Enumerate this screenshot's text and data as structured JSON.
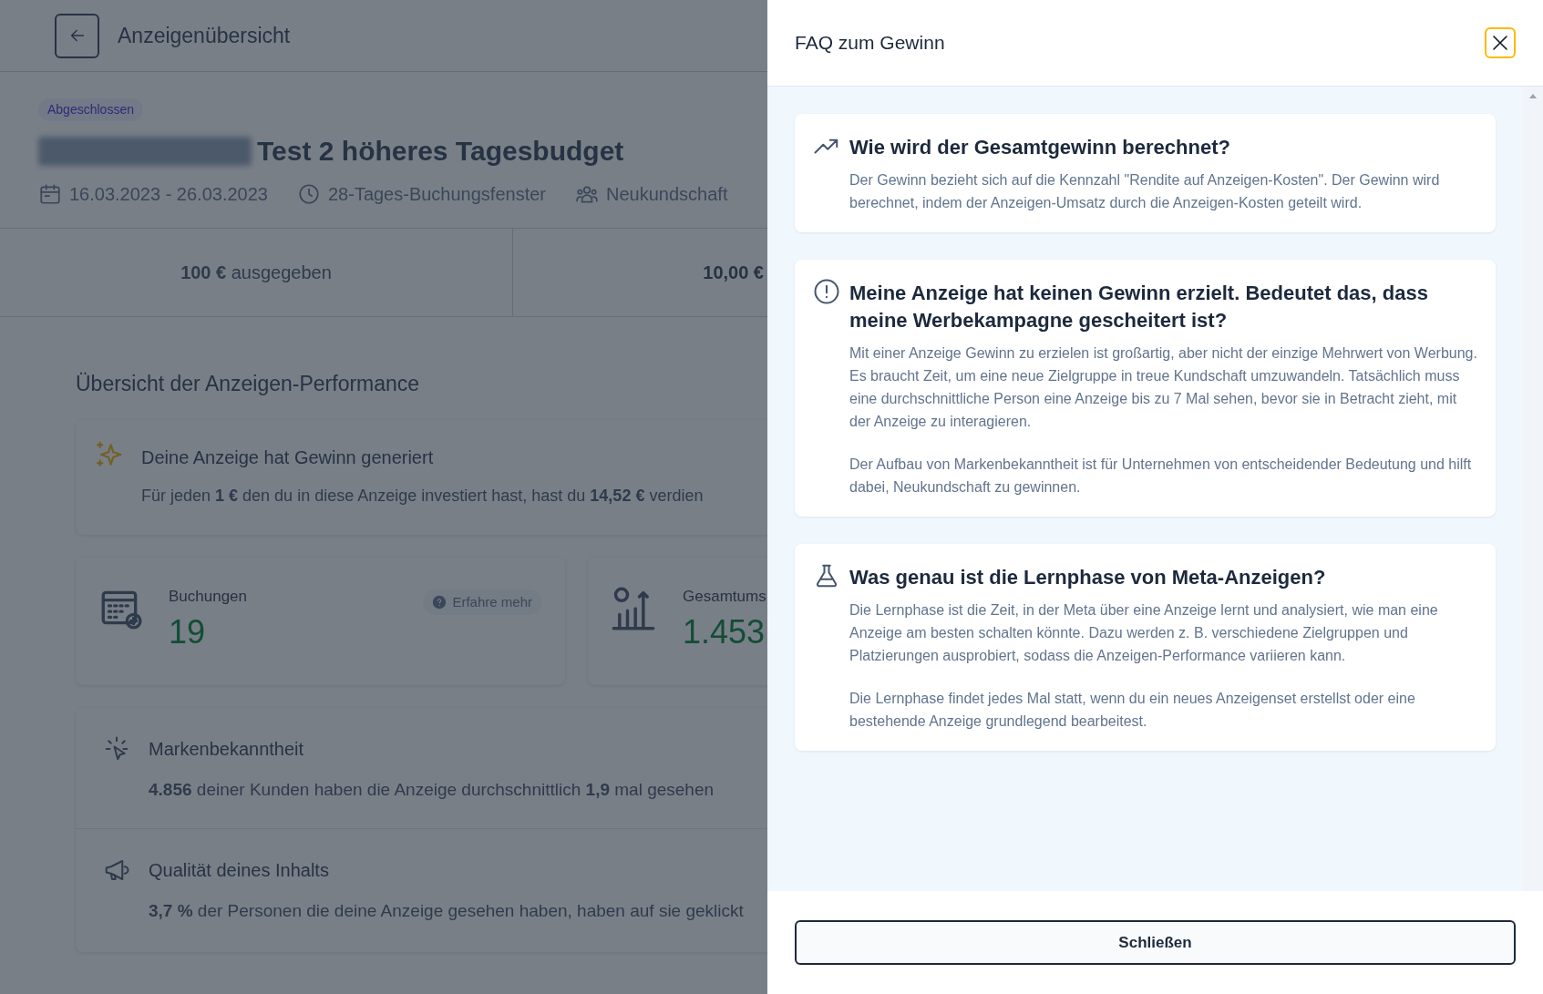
{
  "page": {
    "header_title": "Anzeigenübersicht",
    "status_badge": "Abgeschlossen",
    "ad_title": "Test 2 höheres Tagesbudget",
    "meta": [
      {
        "kind": "date",
        "text": "16.03.2023 - 26.03.2023"
      },
      {
        "kind": "clock",
        "text": "28-Tages-Buchungsfenster"
      },
      {
        "kind": "people",
        "text": "Neukundschaft"
      }
    ],
    "summary": [
      {
        "kind": "accent",
        "text": "**100 €** ausgegeben"
      },
      {
        "kind": "dark",
        "text": "10,00 €"
      }
    ],
    "section_title": "Übersicht der Anzeigen-Performance",
    "insight": {
      "title": "Deine Anzeige hat Gewinn generiert",
      "text": "Für jeden **1 €** den du in diese Anzeige investiert hast, hast du **14,52 €** verdien"
    },
    "metrics": [
      {
        "kind": "calendar",
        "label": "Buchungen",
        "value": "19",
        "help": "Erfahre mehr"
      },
      {
        "kind": "revenue",
        "label": "Gesamtums",
        "value": "1.453"
      }
    ],
    "details": [
      {
        "kind": "cursor",
        "title": "Markenbekanntheit",
        "text": "**4.856** deiner Kunden haben die Anzeige durchschnittlich **1,9** mal gesehen"
      },
      {
        "kind": "megaphone",
        "title": "Qualität deines Inhalts",
        "text": "**3,7 %** der Personen die deine Anzeige gesehen haben, haben auf sie geklickt"
      }
    ]
  },
  "drawer": {
    "title": "FAQ zum Gewinn",
    "faqs": [
      {
        "kind": "trend",
        "question": "Wie wird der Gesamtgewinn berechnet?",
        "paragraphs": [
          "Der Gewinn bezieht sich auf die Kennzahl \"Rendite auf Anzeigen-Kosten\". Der Gewinn wird berechnet, indem der Anzeigen-Umsatz durch die Anzeigen-Kosten geteilt wird."
        ]
      },
      {
        "kind": "alert",
        "question": "Meine Anzeige hat keinen Gewinn erzielt. Bedeutet das, dass meine Werbekampagne gescheitert ist?",
        "paragraphs": [
          "Mit einer Anzeige Gewinn zu erzielen ist großartig, aber nicht der einzige Mehrwert von Werbung. Es braucht Zeit, um eine neue Zielgruppe in treue Kundschaft umzuwandeln. Tatsächlich muss eine durchschnittliche Person eine Anzeige bis zu 7 Mal sehen, bevor sie in Betracht zieht, mit der Anzeige zu interagieren.",
          "Der Aufbau von Markenbekanntheit ist für Unternehmen von entscheidender Bedeutung und hilft dabei, Neukundschaft zu gewinnen."
        ]
      },
      {
        "kind": "flask",
        "question": "Was genau ist die Lernphase von Meta-Anzeigen?",
        "paragraphs": [
          "Die Lernphase ist die Zeit, in der Meta über eine Anzeige lernt und analysiert, wie man eine Anzeige am besten schalten könnte. Dazu werden z. B. verschiedene Zielgruppen und Platzierungen ausprobiert, sodass die Anzeigen-Performance variieren kann.",
          "Die Lernphase findet jedes Mal statt, wenn du ein neues Anzeigenset erstellst oder eine bestehende Anzeige grundlegend bearbeitest."
        ]
      }
    ],
    "close_button": "Schließen"
  }
}
